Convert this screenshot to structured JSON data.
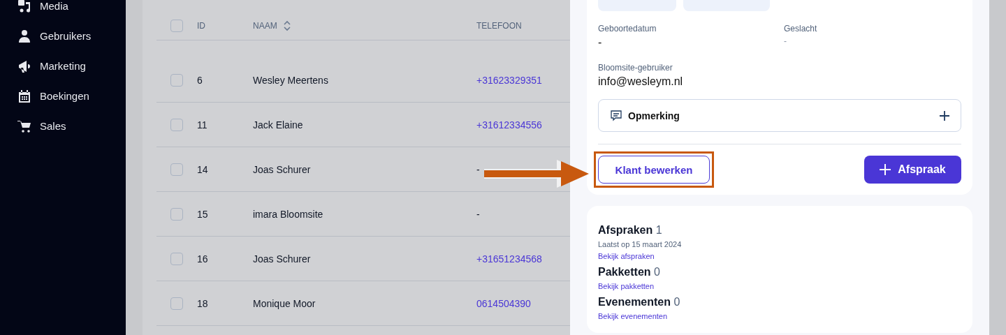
{
  "sidebar": {
    "items": [
      {
        "label": "Media"
      },
      {
        "label": "Gebruikers"
      },
      {
        "label": "Marketing"
      },
      {
        "label": "Boekingen"
      },
      {
        "label": "Sales"
      }
    ]
  },
  "table": {
    "all_checked": false,
    "columns": [
      "ID",
      "NAAM",
      "TELEFOON"
    ],
    "rows": [
      {
        "checked": false,
        "id": "6",
        "name": "Wesley Meertens",
        "phone": "+31623329351"
      },
      {
        "checked": false,
        "id": "11",
        "name": "Jack Elaine",
        "phone": "+31612334556"
      },
      {
        "checked": false,
        "id": "14",
        "name": "Joas Schurer",
        "phone": "-"
      },
      {
        "checked": false,
        "id": "15",
        "name": "imara Bloomsite",
        "phone": "-"
      },
      {
        "checked": false,
        "id": "16",
        "name": "Joas Schurer",
        "phone": "+31651234568"
      },
      {
        "checked": false,
        "id": "18",
        "name": "Monique Moor",
        "phone": "0614504390"
      }
    ]
  },
  "drawer": {
    "fields": [
      {
        "label": "Geboortedatum",
        "value": "-"
      },
      {
        "label": "Geslacht",
        "value": "-"
      }
    ],
    "user_label": "Bloomsite-gebruiker",
    "user_value": "info@wesleym.nl",
    "note": "Opmerking",
    "edit_button": "Klant bewerken",
    "add_button": "Afspraak",
    "sections": [
      {
        "title": "Afspraken",
        "count": "1",
        "subtitle": "Laatst op 15 maart 2024",
        "link": "Bekijk afspraken"
      },
      {
        "title": "Pakketten",
        "count": "0",
        "link": "Bekijk pakketten"
      },
      {
        "title": "Evenementen",
        "count": "0",
        "link": "Bekijk evenementen"
      }
    ]
  }
}
